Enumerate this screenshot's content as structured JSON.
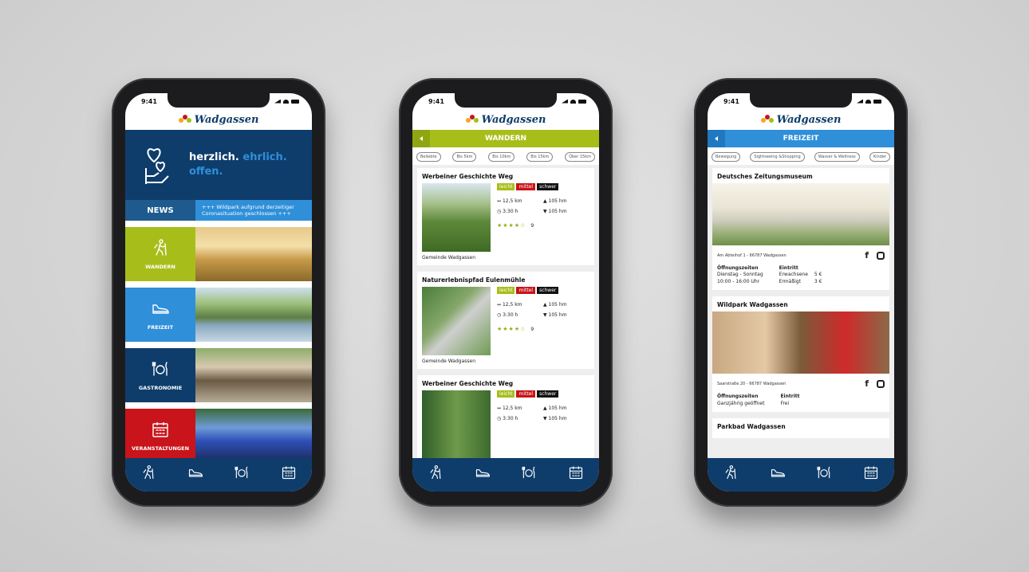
{
  "status_time": "9:41",
  "logo": "Wadgassen",
  "colors": {
    "navy": "#0e3d6b",
    "blue": "#2f8fd9",
    "green": "#a7be1a",
    "red": "#c8141a"
  },
  "phone1": {
    "hero": {
      "line1": "herzlich.",
      "line2": "ehrlich.",
      "line3": "offen."
    },
    "news": {
      "label": "NEWS",
      "ticker": "+++ Wildpark aufgrund derzeitiger Coronasituation geschlossen +++"
    },
    "categories": [
      {
        "label": "WANDERN",
        "icon": "hiker-icon",
        "color": "#a7be1a"
      },
      {
        "label": "FREIZEIT",
        "icon": "sneaker-icon",
        "color": "#2f8fd9"
      },
      {
        "label": "GASTRONOMIE",
        "icon": "plate-cutlery-icon",
        "color": "#0e3d6b"
      },
      {
        "label": "VERANSTALTUNGEN",
        "icon": "calendar-icon",
        "color": "#c8141a"
      }
    ]
  },
  "phone2": {
    "header": "WANDERN",
    "filters": [
      "Beliebte",
      "Bis 5km",
      "Bis 10km",
      "Bis 15km",
      "Über 15km"
    ],
    "difficulty": {
      "easy": "leicht",
      "medium": "mittel",
      "hard": "schwer"
    },
    "trails": [
      {
        "title": "Werbeiner Geschichte Weg",
        "distance": "12,5 km",
        "up": "105 hm",
        "time": "3:30 h",
        "down": "105 hm",
        "stars": "★★★★☆",
        "count": "9",
        "location": "Gemeinde Wadgassen"
      },
      {
        "title": "Naturerlebnispfad Eulenmühle",
        "distance": "12,5 km",
        "up": "105 hm",
        "time": "3:30 h",
        "down": "105 hm",
        "stars": "★★★★☆",
        "count": "9",
        "location": "Gemeinde Wadgassen"
      },
      {
        "title": "Werbeiner Geschichte Weg",
        "distance": "12,5 km",
        "up": "105 hm",
        "time": "3:30 h",
        "down": "105 hm"
      }
    ]
  },
  "phone3": {
    "header": "FREIZEIT",
    "filters": [
      "Bewegung",
      "Sightseeing &Shopping",
      "Wasser & Wellness",
      "Kinder"
    ],
    "places": [
      {
        "title": "Deutsches Zeitungsmuseum",
        "address": "Am Abteihof 1 - 66787 Wadgassen",
        "hours_label": "Öffnungszeiten",
        "hours": [
          "Dienstag - Sonntag",
          "10:00 - 16:00 Uhr"
        ],
        "fee_label": "Eintritt",
        "fees": [
          [
            "Erwachsene",
            "5 €"
          ],
          [
            "Ermäßigt",
            "3 €"
          ]
        ]
      },
      {
        "title": "Wildpark Wadgassen",
        "address": "Saarstraße 20 - 66787 Wadgassen",
        "hours_label": "Öffnungszeiten",
        "hours": [
          "Ganzjährig geöffnet"
        ],
        "fee_label": "Eintritt",
        "fee": "Frei"
      },
      {
        "title": "Parkbad Wadgassen"
      }
    ]
  }
}
